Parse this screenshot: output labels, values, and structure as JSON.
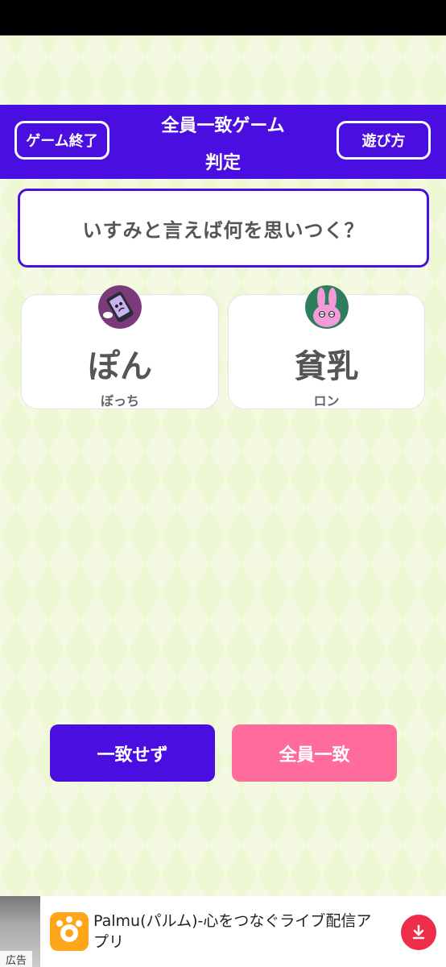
{
  "header": {
    "title_line1": "全員一致ゲーム",
    "title_line2": "判定",
    "end_game_label": "ゲーム終了",
    "how_to_play_label": "遊び方"
  },
  "question": {
    "text": "いすみと言えば何を思いつく？"
  },
  "answers": [
    {
      "answer": "ぽん",
      "player": "ぼっち",
      "avatar_icon": "phone-character-icon"
    },
    {
      "answer": "貧乳",
      "player": "ロン",
      "avatar_icon": "rabbit-character-icon"
    }
  ],
  "actions": {
    "not_match_label": "一致せず",
    "all_match_label": "全員一致"
  },
  "ad": {
    "tag": "広告",
    "app_name": "Palmu(パルム)-心をつなぐライブ配信アプリ",
    "download_icon": "download-icon",
    "app_icon": "palmu-app-icon"
  },
  "colors": {
    "primary": "#4a0fe0",
    "accent_pink": "#ff6b9b",
    "background": "#eef7d3"
  }
}
